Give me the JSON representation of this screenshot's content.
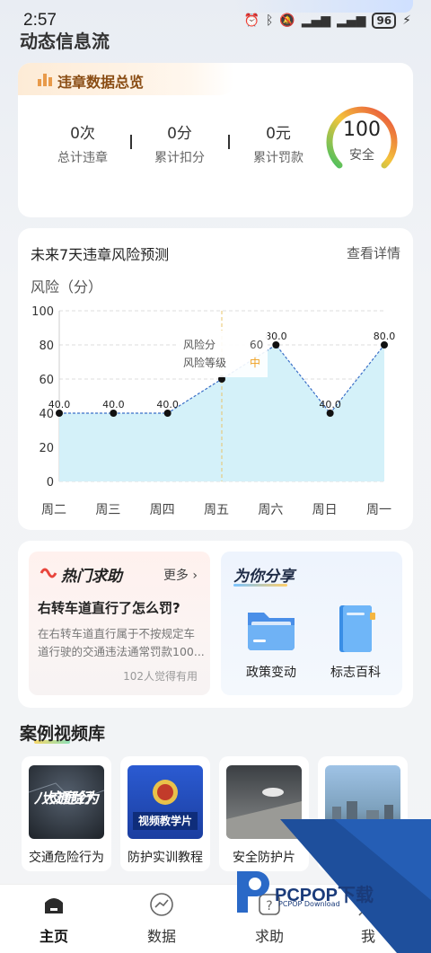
{
  "status_bar": {
    "time": "2:57",
    "battery": "96",
    "icons": [
      "alarm-icon",
      "bluetooth-icon",
      "mute-icon",
      "signal-icon",
      "wifi-signal-icon",
      "battery-icon",
      "charging-icon"
    ]
  },
  "page": {
    "title": "动态信息流"
  },
  "overview": {
    "title": "违章数据总览",
    "stats": [
      {
        "value": "0次",
        "label": "总计违章"
      },
      {
        "value": "0分",
        "label": "累计扣分"
      },
      {
        "value": "0元",
        "label": "累计罚款"
      }
    ],
    "score": {
      "value": "100",
      "label": "安全"
    }
  },
  "forecast": {
    "title": "未来7天违章风险预测",
    "more": "查看详情",
    "ylabel": "风险（分）",
    "tooltip": {
      "score_label": "风险分",
      "score_value": "60",
      "level_label": "风险等级",
      "level_value": "中"
    }
  },
  "chart_data": {
    "type": "area",
    "categories": [
      "周二",
      "周三",
      "周四",
      "周五",
      "周六",
      "周日",
      "周一"
    ],
    "values": [
      40,
      40,
      40,
      60,
      80,
      40,
      80
    ],
    "value_labels": [
      "40.0",
      "40.0",
      "40.0",
      "",
      "80.0",
      "40.0",
      "80.0"
    ],
    "ylabel": "风险（分）",
    "ylim": [
      0,
      100
    ],
    "yticks": [
      0,
      20,
      40,
      60,
      80,
      100
    ],
    "grid": true,
    "colors": {
      "line": "#3b6fc7",
      "fill": "#d4f1f9",
      "grid": "#dddddd",
      "tooltip_level": "#f0a020"
    }
  },
  "hot_help": {
    "title": "热门求助",
    "more": "更多",
    "question": "右转车道直行了怎么罚?",
    "desc": "在右转车道直行属于不按规定车道行驶的交通违法通常罚款100...",
    "useful": "102人觉得有用"
  },
  "share": {
    "title": "为你分享",
    "items": [
      {
        "label": "政策变动",
        "icon": "folder-icon"
      },
      {
        "label": "标志百科",
        "icon": "book-icon"
      }
    ]
  },
  "video_library": {
    "title": "案例视频库",
    "items": [
      {
        "label": "交通危险行为",
        "thumb_text": "八大交通危险行为"
      },
      {
        "label": "防护实训教程",
        "thumb_text": "视频教学片"
      },
      {
        "label": "安全防护片",
        "thumb_text": ""
      },
      {
        "label": "",
        "thumb_text": ""
      }
    ]
  },
  "bottom_nav": {
    "items": [
      {
        "label": "主页",
        "icon": "home-icon"
      },
      {
        "label": "数据",
        "icon": "chart-icon"
      },
      {
        "label": "求助",
        "icon": "help-icon"
      },
      {
        "label": "我",
        "icon": "profile-icon"
      }
    ]
  },
  "watermark": {
    "text": "PCPOP下载",
    "sub": "PCPOP Download"
  }
}
